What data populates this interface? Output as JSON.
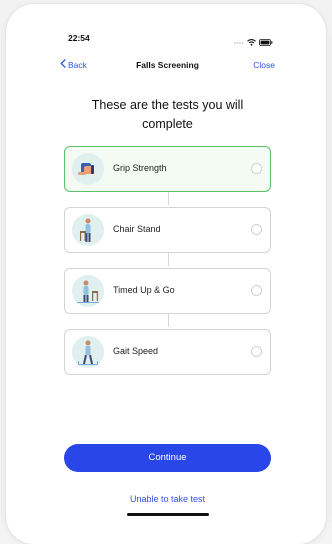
{
  "status_bar": {
    "time": "22:54"
  },
  "nav": {
    "back_label": "Back",
    "title": "Falls Screening",
    "close_label": "Close"
  },
  "heading": "These are the tests you will complete",
  "tests": [
    {
      "label": "Grip Strength",
      "selected": true,
      "icon": "grip-strength-illustration"
    },
    {
      "label": "Chair Stand",
      "selected": false,
      "icon": "chair-stand-illustration"
    },
    {
      "label": "Timed Up & Go",
      "selected": false,
      "icon": "timed-up-and-go-illustration"
    },
    {
      "label": "Gait Speed",
      "selected": false,
      "icon": "gait-speed-illustration"
    }
  ],
  "continue_label": "Continue",
  "unable_label": "Unable to take test",
  "colors": {
    "accent": "#2946e8",
    "link": "#2f55e6",
    "active_border": "#5ac267"
  }
}
